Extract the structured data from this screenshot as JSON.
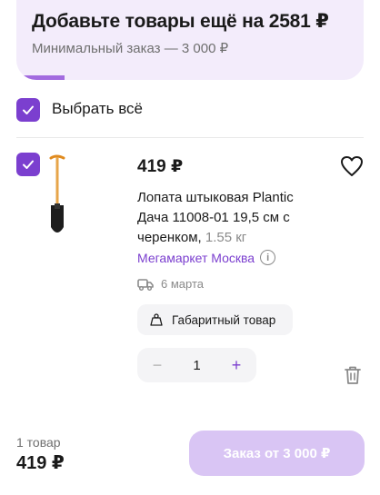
{
  "banner": {
    "title": "Добавьте товары ещё на 2581 ₽",
    "subtitle": "Минимальный заказ — 3 000 ₽",
    "progress": 0.14
  },
  "select_all": {
    "label": "Выбрать всё",
    "checked": true
  },
  "item": {
    "checked": true,
    "price": "419 ₽",
    "name": "Лопата штыковая Plantic Дача 11008-01 19,5 см с черенком,",
    "weight": " 1.55 кг",
    "seller": "Мегамаркет Москва",
    "info_icon_glyph": "i",
    "delivery": "6 марта",
    "tag": "Габаритный товар",
    "quantity": "1",
    "minus_glyph": "−",
    "plus_glyph": "+"
  },
  "footer": {
    "count": "1 товар",
    "total": "419 ₽",
    "order_label": "Заказ от 3 000 ₽"
  },
  "colors": {
    "accent": "#7b3fcf",
    "banner_bg": "#f3ecfb",
    "order_disabled": "#d9c5f4"
  },
  "icons": {
    "checkbox": "check-icon",
    "favorite": "heart-icon",
    "delivery": "truck-icon",
    "tag": "weight-icon",
    "delete": "trash-icon",
    "info": "info-icon"
  }
}
